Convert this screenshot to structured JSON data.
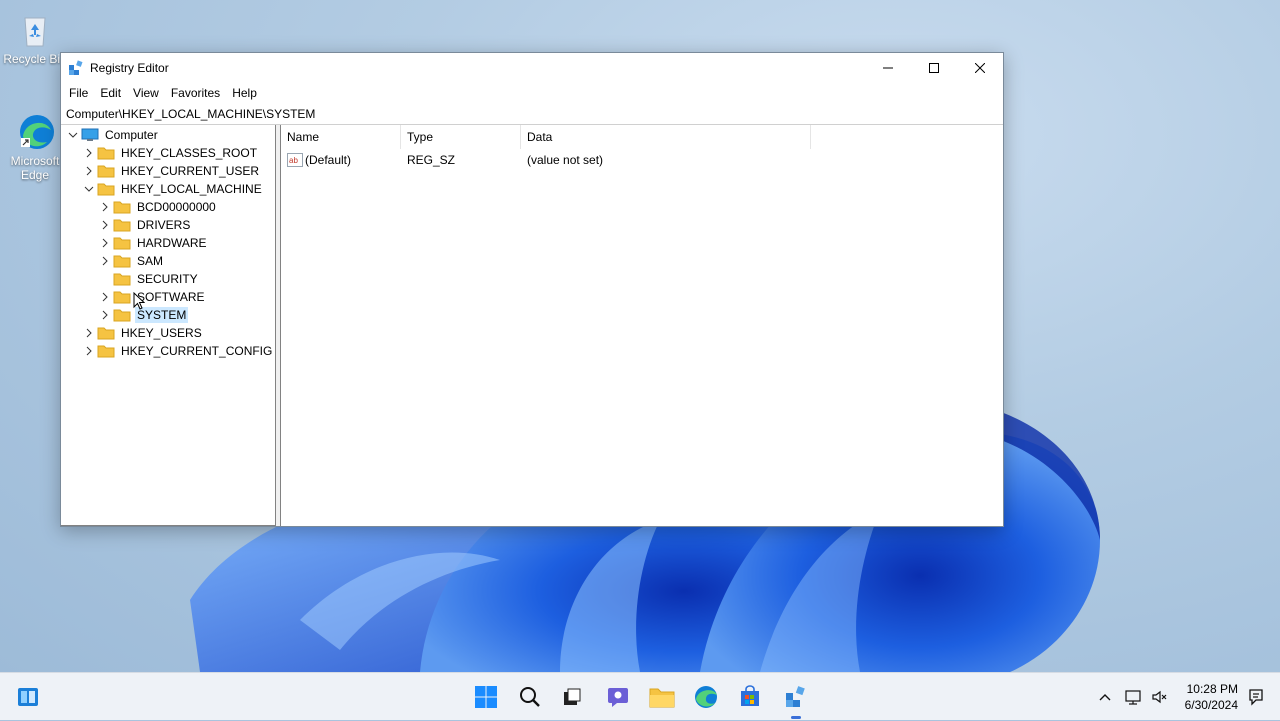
{
  "desktop": {
    "icons": [
      {
        "label": "Recycle Bin"
      },
      {
        "label": "Microsoft Edge"
      }
    ]
  },
  "window": {
    "title": "Registry Editor",
    "menu": [
      "File",
      "Edit",
      "View",
      "Favorites",
      "Help"
    ],
    "address": "Computer\\HKEY_LOCAL_MACHINE\\SYSTEM"
  },
  "tree": {
    "root": "Computer",
    "hives": [
      "HKEY_CLASSES_ROOT",
      "HKEY_CURRENT_USER",
      "HKEY_LOCAL_MACHINE",
      "HKEY_USERS",
      "HKEY_CURRENT_CONFIG"
    ],
    "hklm_children": [
      "BCD00000000",
      "DRIVERS",
      "HARDWARE",
      "SAM",
      "SECURITY",
      "SOFTWARE",
      "SYSTEM"
    ],
    "selected": "SYSTEM"
  },
  "list": {
    "columns": [
      "Name",
      "Type",
      "Data"
    ],
    "rows": [
      {
        "name": "(Default)",
        "type": "REG_SZ",
        "data": "(value not set)"
      }
    ]
  },
  "taskbar": {
    "time": "10:28 PM",
    "date": "6/30/2024"
  },
  "colors": {
    "accent": "#0067c0",
    "folder": "#f5c342",
    "selection": "#cce8ff"
  }
}
